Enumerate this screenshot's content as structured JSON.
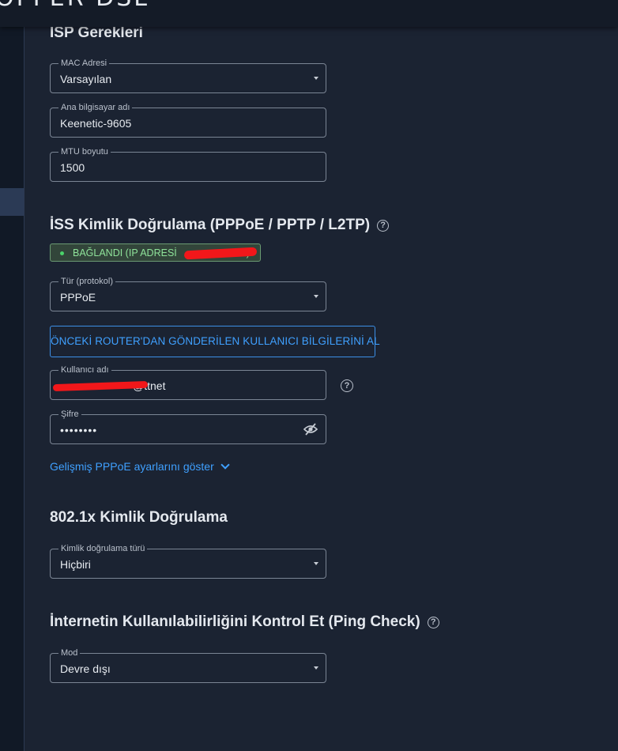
{
  "header": {
    "brand": "OPPER DSL"
  },
  "isp_requirements": {
    "title": "ISP Gerekleri",
    "mac": {
      "label": "MAC Adresi",
      "value": "Varsayılan"
    },
    "hostname": {
      "label": "Ana bilgisayar adı",
      "value": "Keenetic-9605"
    },
    "mtu": {
      "label": "MTU boyutu",
      "value": "1500"
    }
  },
  "iss_auth": {
    "title": "İSS Kimlik Doğrulama (PPPoE / PPTP / L2TP)",
    "status": "BAĞLANDI (IP ADRESİ",
    "status_close": ")",
    "protocol": {
      "label": "Tür (protokol)",
      "value": "PPPoE"
    },
    "fetch_button": "ÖNCEKİ ROUTER'DAN GÖNDERİLEN KULLANICI BİLGİLERİNİ AL",
    "username": {
      "label": "Kullanıcı adı",
      "value": "@ttnet"
    },
    "password": {
      "label": "Şifre",
      "value": "••••••••"
    },
    "advanced_link": "Gelişmiş PPPoE ayarlarını göster"
  },
  "dot1x": {
    "title": "802.1x Kimlik Doğrulama",
    "auth_type": {
      "label": "Kimlik doğrulama türü",
      "value": "Hiçbiri"
    }
  },
  "ping_check": {
    "title": "İnternetin Kullanılabilirliğini Kontrol Et (Ping Check)",
    "mode": {
      "label": "Mod",
      "value": "Devre dışı"
    }
  },
  "colors": {
    "accent": "#3fa0ff",
    "connected": "#8fe39a",
    "redaction": "#f2171a"
  }
}
